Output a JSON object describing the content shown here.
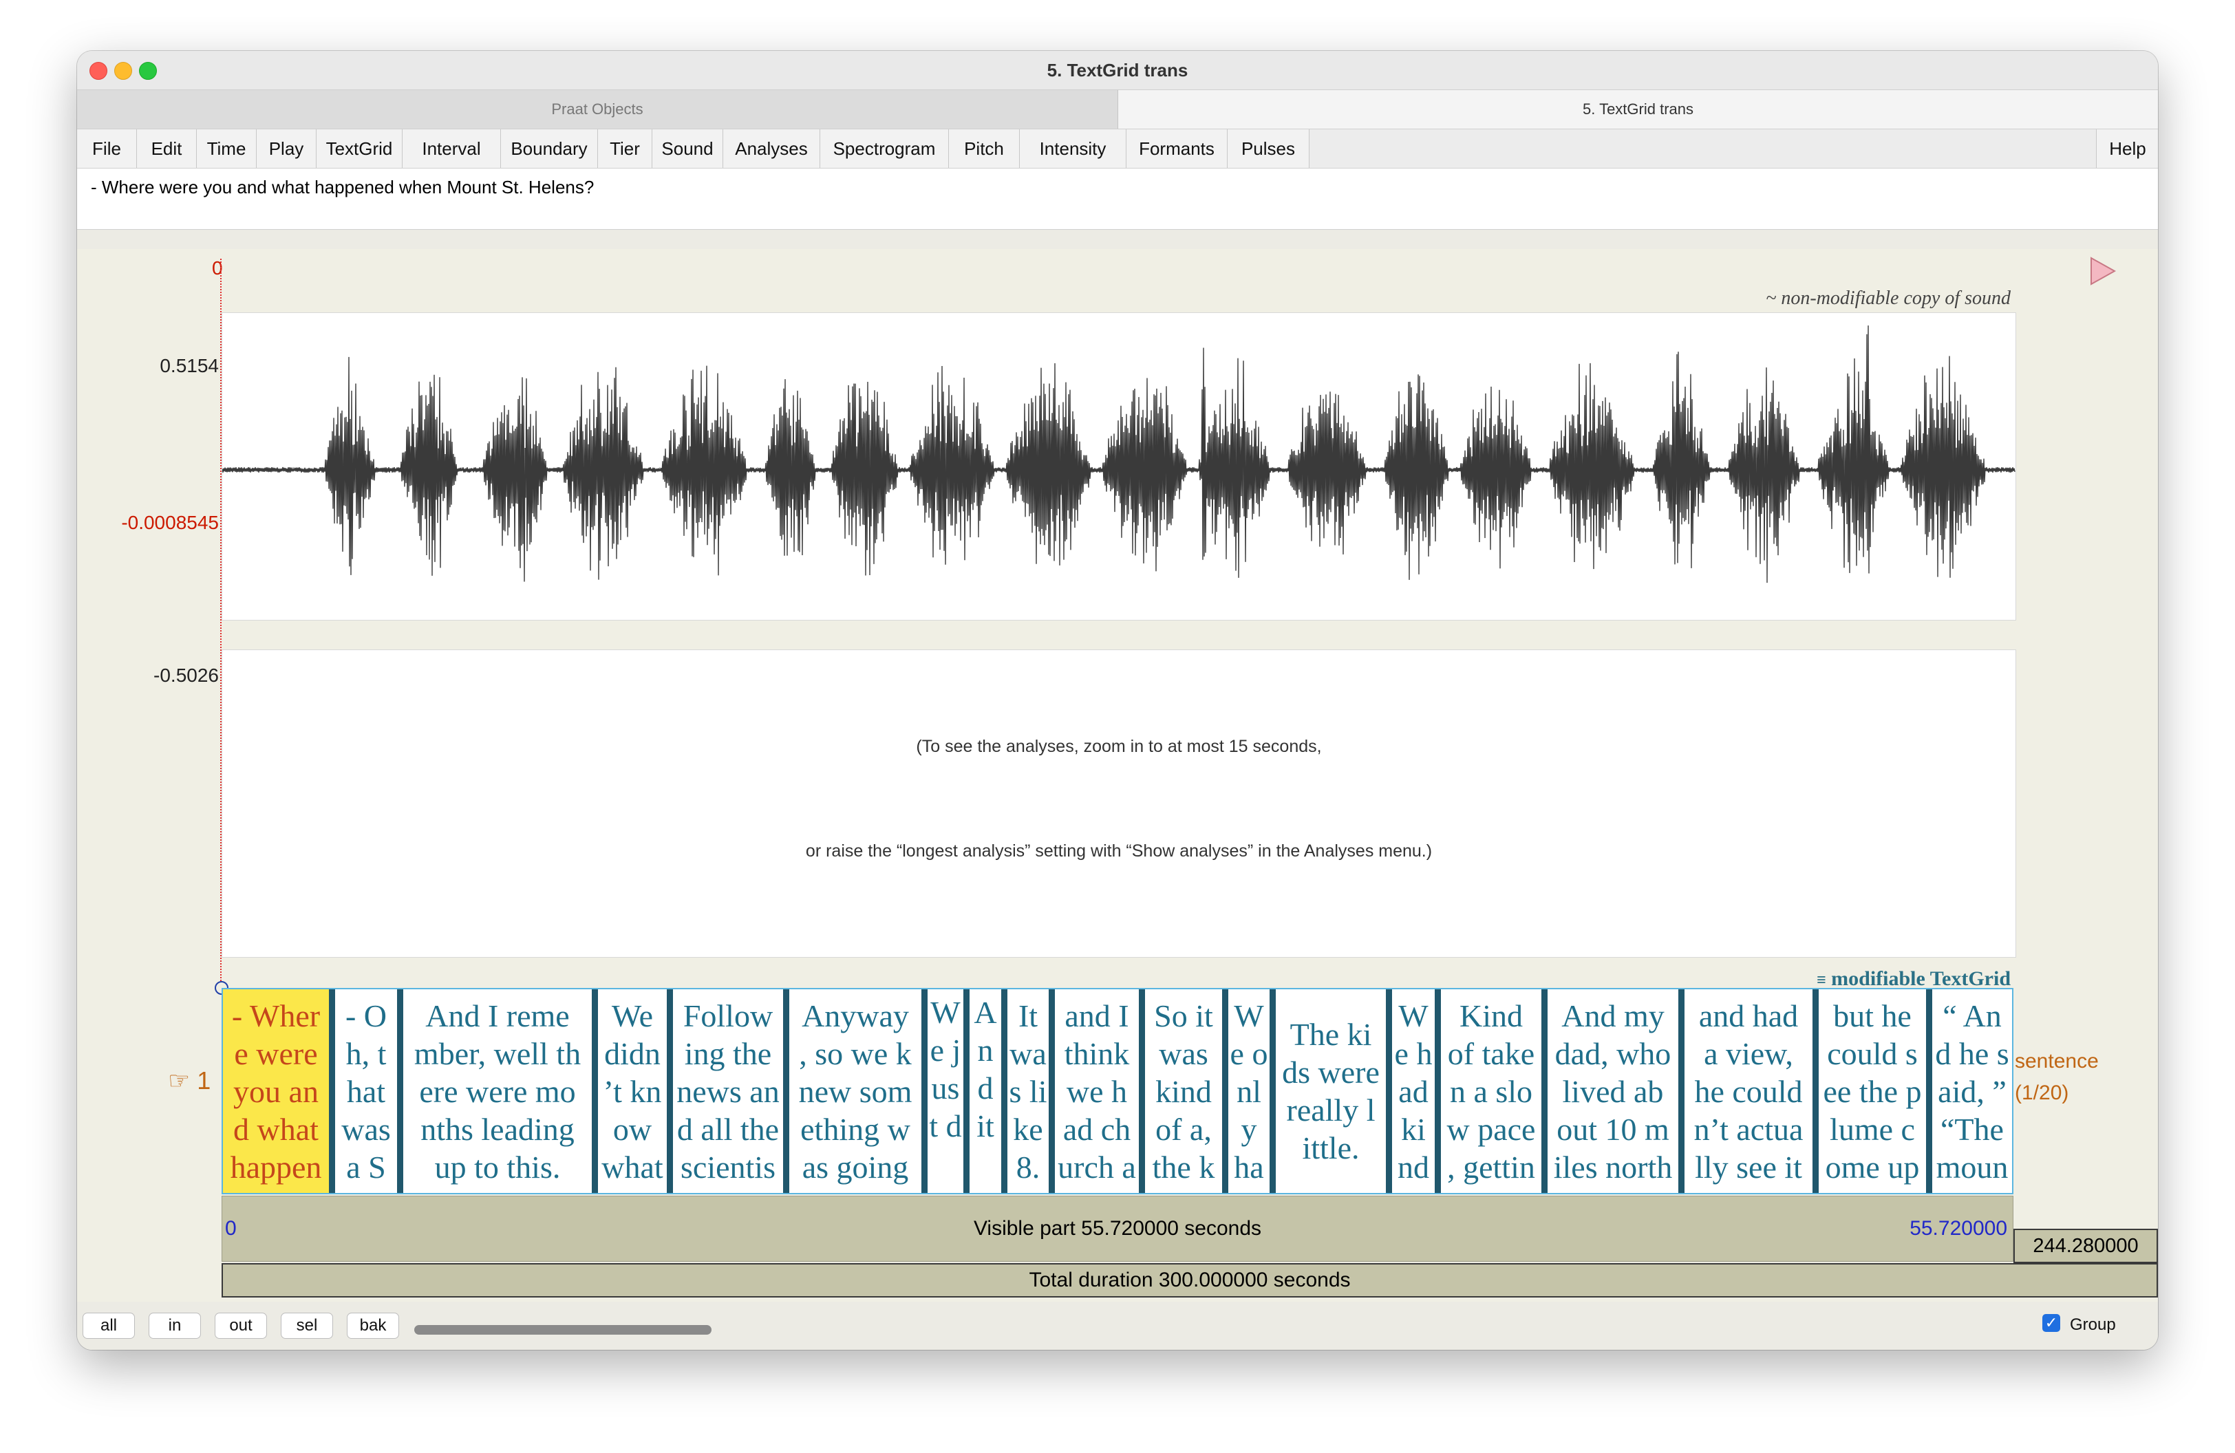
{
  "window": {
    "title": "5. TextGrid trans"
  },
  "tabs": [
    "Praat Objects",
    "5. TextGrid trans"
  ],
  "menu": [
    "File",
    "Edit",
    "Time",
    "Play",
    "TextGrid",
    "Interval",
    "Boundary",
    "Tier",
    "Sound",
    "Analyses",
    "Spectrogram",
    "Pitch",
    "Intensity",
    "Formants",
    "Pulses"
  ],
  "help_label": "Help",
  "text_field": "- Where were you and what happened when Mount St. Helens?",
  "cursor_time": "0",
  "sound": {
    "caption": "~ non-modifiable copy of sound",
    "y_max": "0.5154",
    "y_cursor": "-0.0008545",
    "y_min": "-0.5026"
  },
  "analysis_message": {
    "line1": "(To see the analyses, zoom in to at most 15 seconds,",
    "line2": "or raise the “longest analysis” setting with “Show analyses” in the Analyses menu.)"
  },
  "textgrid": {
    "caption": "modifiable TextGrid",
    "tier_number": "☞ 1",
    "tier_name": "sentence",
    "tier_count": "(1/20)",
    "intervals": [
      "- Wher\ne were\nyou an\nd what\nhappen",
      "- O\nh, t\nhat\nwas\na S",
      "And I reme\nmber, well th\nere were mo\nnths leading\nup to this.",
      "We\ndidn\n’t kn\now\nwhat",
      "Follow\ning the\nnews an\nd all the\nscientis",
      "Anyway\n, so we k\nnew som\nething w\nas going",
      "W\ne j\nus\nt d",
      "A\nn\nd\nit",
      "It\nwa\ns li\nke\n8.",
      "and I\nthink\nwe h\nad ch\nurch a",
      "So it\nwas\nkind\nof a,\nthe k",
      "W\ne o\nnl\ny\nha",
      "The ki\nds were\nreally l\nittle.",
      "W\ne h\nad\nki\nnd",
      "Kind\nof take\nn a slo\nw pace\n, gettin",
      "And my\ndad, who\nlived ab\nout 10 m\niles north",
      "and had\na view,\nhe could\nn’t actua\nlly see it",
      "but he\ncould s\nee the p\nlume c\nome up",
      "“ An\nd he s\naid, ”\n“The\nmoun"
    ]
  },
  "time": {
    "visible_start": "0",
    "visible_label": "Visible part 55.720000 seconds",
    "visible_end": "55.720000",
    "remaining": "244.280000",
    "total_label": "Total duration 300.000000 seconds"
  },
  "zoom_buttons": [
    "all",
    "in",
    "out",
    "sel",
    "bak"
  ],
  "group": {
    "label": "Group",
    "checked": true
  }
}
